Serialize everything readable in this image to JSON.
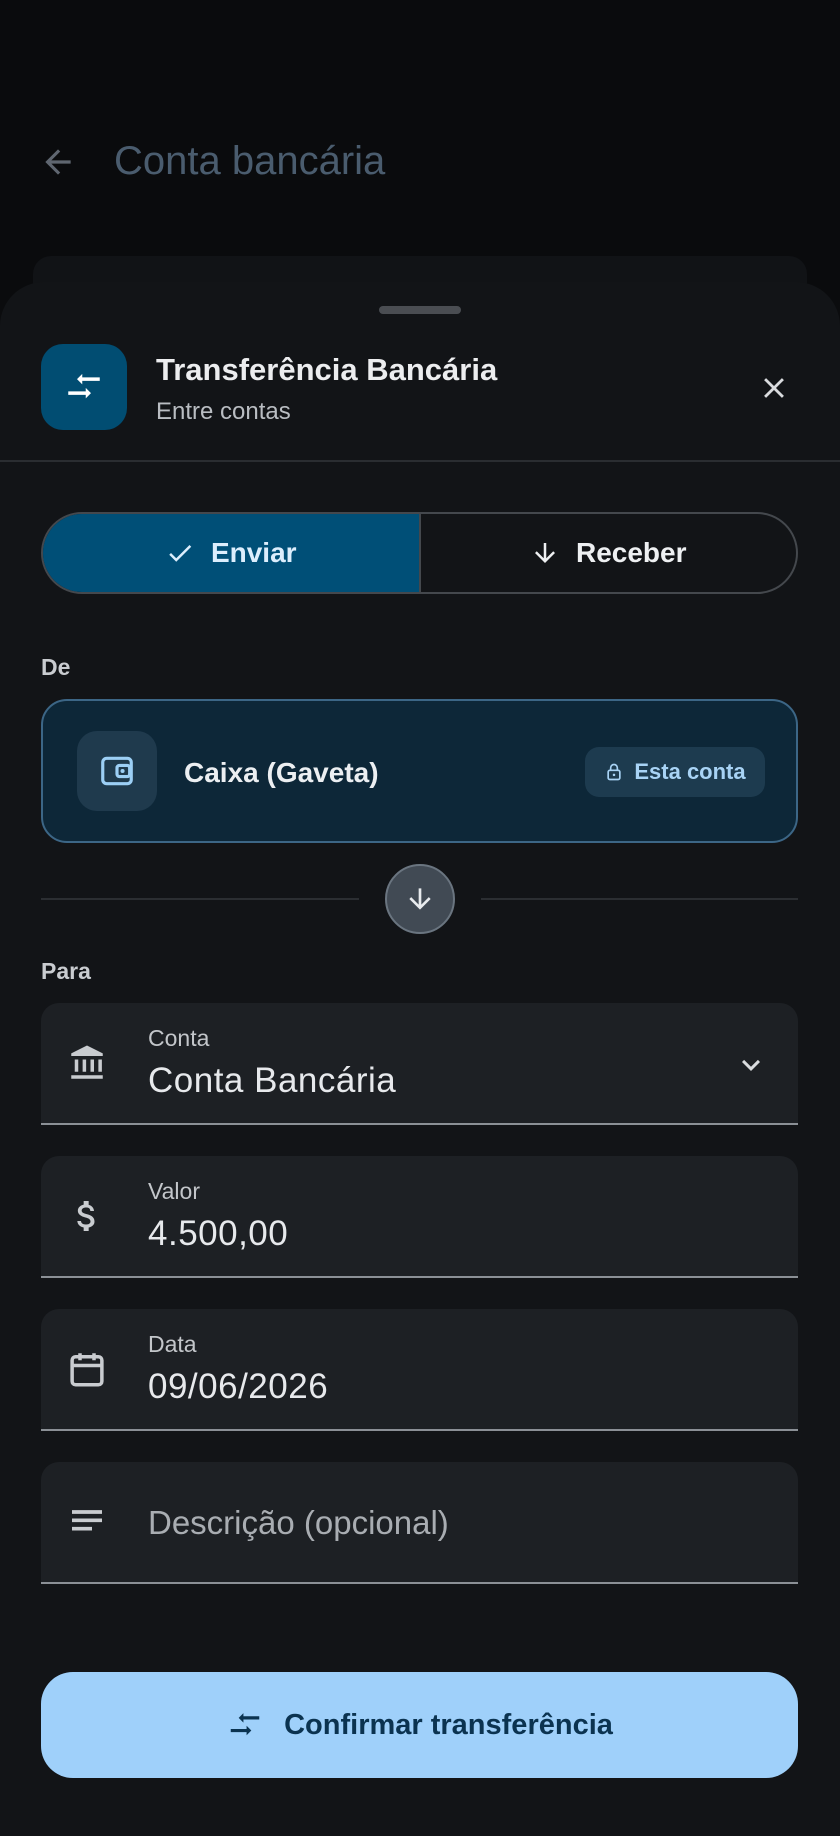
{
  "background": {
    "title": "Conta bancária"
  },
  "sheet": {
    "title": "Transferência Bancária",
    "subtitle": "Entre contas"
  },
  "direction": {
    "send_label": "Enviar",
    "receive_label": "Receber",
    "selected": "Enviar"
  },
  "from": {
    "label": "De",
    "account_name": "Caixa (Gaveta)",
    "badge": "Esta conta"
  },
  "to": {
    "label": "Para"
  },
  "fields": {
    "account": {
      "label": "Conta",
      "value": "Conta Bancária"
    },
    "amount": {
      "label": "Valor",
      "value": "4.500,00"
    },
    "date": {
      "label": "Data",
      "value": "09/06/2026"
    },
    "description": {
      "placeholder": "Descrição (opcional)"
    }
  },
  "confirm_label": "Confirmar transferência",
  "colors": {
    "accent": "#004f77",
    "button": "#9fd0fa",
    "surface": "#121417"
  },
  "icons": [
    "arrow-left-icon",
    "swap-icon",
    "close-icon",
    "check-icon",
    "arrow-down-icon",
    "wallet-icon",
    "lock-icon",
    "bank-icon",
    "chevron-down-icon",
    "dollar-icon",
    "calendar-icon",
    "notes-icon"
  ]
}
